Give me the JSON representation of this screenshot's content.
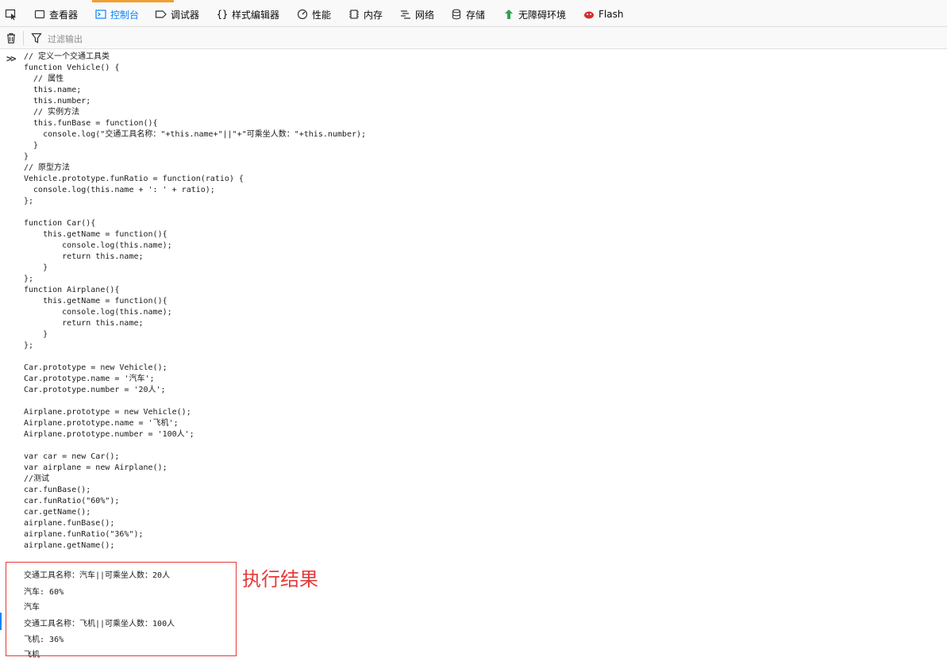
{
  "toolbar": {
    "tabs": [
      {
        "label": "查看器",
        "icon": "inspector-icon"
      },
      {
        "label": "控制台",
        "icon": "console-icon",
        "active": true
      },
      {
        "label": "调试器",
        "icon": "debugger-icon"
      },
      {
        "label": "样式编辑器",
        "icon": "style-editor-icon"
      },
      {
        "label": "性能",
        "icon": "performance-icon"
      },
      {
        "label": "内存",
        "icon": "memory-icon"
      },
      {
        "label": "网络",
        "icon": "network-icon"
      },
      {
        "label": "存储",
        "icon": "storage-icon"
      },
      {
        "label": "无障碍环境",
        "icon": "accessibility-icon"
      },
      {
        "label": "Flash",
        "icon": "flash-icon"
      }
    ],
    "accent_color": "#0a84ff"
  },
  "filterbar": {
    "placeholder": "过滤输出"
  },
  "console": {
    "input_code": "// 定义一个交通工具类\nfunction Vehicle() {\n  // 属性\n  this.name;\n  this.number;\n  // 实例方法\n  this.funBase = function(){\n    console.log(\"交通工具名称：\"+this.name+\"||\"+\"可乘坐人数：\"+this.number);\n  }\n}\n// 原型方法\nVehicle.prototype.funRatio = function(ratio) {\n  console.log(this.name + ': ' + ratio);\n};\n\nfunction Car(){\n    this.getName = function(){\n        console.log(this.name);\n        return this.name;\n    }\n};\nfunction Airplane(){\n    this.getName = function(){\n        console.log(this.name);\n        return this.name;\n    }\n};\n\nCar.prototype = new Vehicle();\nCar.prototype.name = '汽车';\nCar.prototype.number = '20人';\n\nAirplane.prototype = new Vehicle();\nAirplane.prototype.name = '飞机';\nAirplane.prototype.number = '100人';\n\nvar car = new Car();\nvar airplane = new Airplane();\n//测试\ncar.funBase();\ncar.funRatio(\"60%\");\ncar.getName();\nairplane.funBase();\nairplane.funRatio(\"36%\");\nairplane.getName();",
    "outputs": [
      "交通工具名称：汽车||可乘坐人数：20人",
      "汽车: 60%",
      "汽车",
      "交通工具名称：飞机||可乘坐人数：100人",
      "飞机: 36%",
      "飞机"
    ]
  },
  "annotation": {
    "label": "执行结果",
    "color": "#e33a3a"
  }
}
